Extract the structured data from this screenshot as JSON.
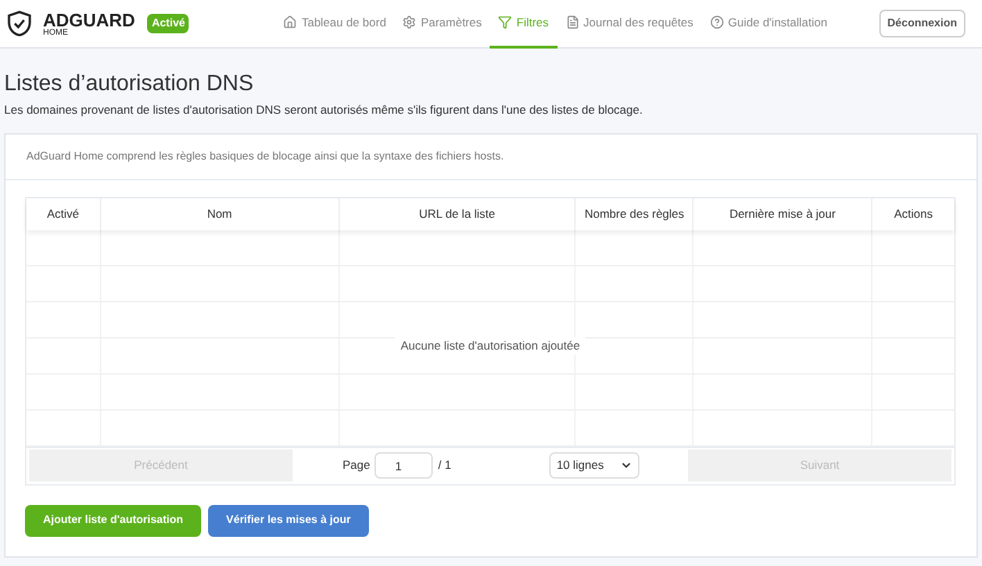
{
  "header": {
    "logo": "ADGUARD",
    "logo_sub": "HOME",
    "status_badge": "Activé",
    "nav": [
      {
        "label": "Tableau de bord",
        "selected": false
      },
      {
        "label": "Paramètres",
        "selected": false
      },
      {
        "label": "Filtres",
        "selected": true
      },
      {
        "label": "Journal des requêtes",
        "selected": false
      },
      {
        "label": "Guide d'installation",
        "selected": false
      }
    ],
    "logout": "Déconnexion"
  },
  "page": {
    "title": "Listes d’autorisation DNS",
    "subtitle": "Les domaines provenant de listes d'autorisation DNS seront autorisés même s'ils figurent dans l'une des listes de blocage."
  },
  "card": {
    "intro": "AdGuard Home comprend les règles basiques de blocage ainsi que la syntaxe des fichiers hosts.",
    "table": {
      "columns": [
        "Activé",
        "Nom",
        "URL de la liste",
        "Nombre des règles",
        "Dernière mise à jour",
        "Actions"
      ],
      "empty_message": "Aucune liste d'autorisation ajoutée"
    },
    "pagination": {
      "previous": "Précédent",
      "page_label": "Page",
      "page_value": "1",
      "page_total": "/ 1",
      "rows_select": "10 lignes",
      "next": "Suivant"
    },
    "buttons": [
      {
        "label": "Ajouter liste d'autorisation",
        "kind": "primary"
      },
      {
        "label": "Vérifier les mises à jour",
        "kind": "secondary"
      }
    ]
  }
}
